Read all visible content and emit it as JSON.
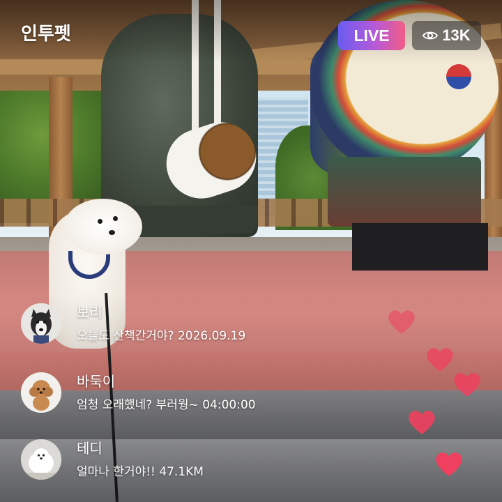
{
  "app": {
    "title": "인투펫"
  },
  "stream": {
    "live_label": "LIVE",
    "viewer_count": "13K",
    "viewer_icon": "eye-icon"
  },
  "comments": [
    {
      "name": "보리",
      "text": "오늘도 산책간거야? 2026.09.19",
      "avatar": "husky-dog-avatar"
    },
    {
      "name": "바둑이",
      "text": "엄청 오래했네? 부러웡~ 04:00:00",
      "avatar": "poodle-dog-avatar"
    },
    {
      "name": "테디",
      "text": "얼마나 한거야!! 47.1KM",
      "avatar": "pomeranian-dog-avatar"
    }
  ],
  "reactions": {
    "icon": "heart-icon",
    "color": "#f0405f"
  },
  "colors": {
    "live_gradient": [
      "#6a5cf0",
      "#b65ad8",
      "#f25c86"
    ],
    "viewer_badge_bg": "rgba(40,40,40,0.55)"
  }
}
